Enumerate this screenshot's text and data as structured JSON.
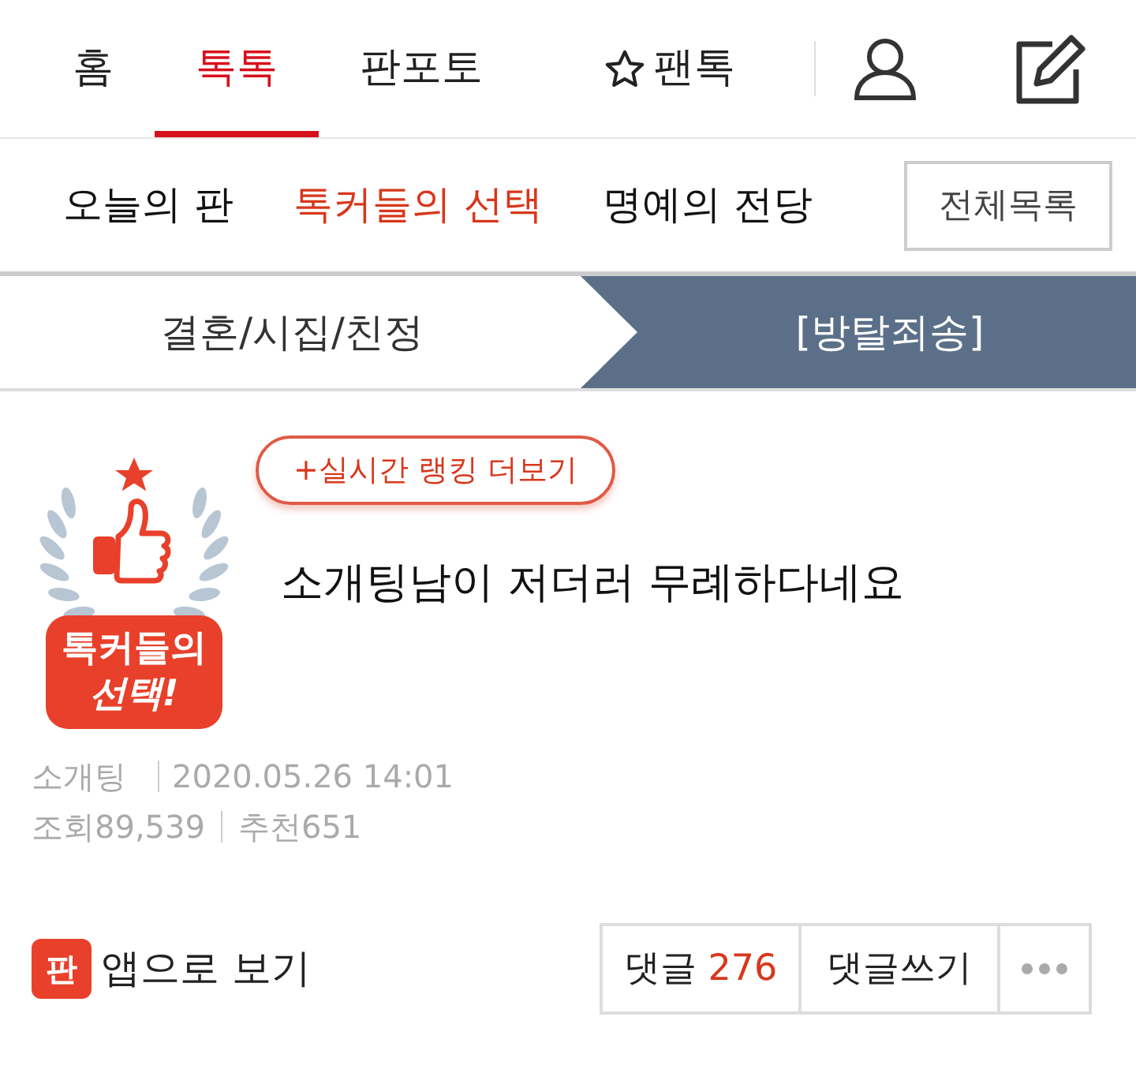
{
  "top_nav": {
    "tabs": [
      {
        "label": "홈",
        "selected": false,
        "star": false
      },
      {
        "label": "톡톡",
        "selected": true,
        "star": false
      },
      {
        "label": "판포토",
        "selected": false,
        "star": false
      },
      {
        "label": "팬톡",
        "selected": false,
        "star": true
      }
    ]
  },
  "sub_nav": {
    "items": [
      {
        "label": "오늘의 판",
        "selected": false
      },
      {
        "label": "톡커들의 선택",
        "selected": true
      },
      {
        "label": "명예의 전당",
        "selected": false
      }
    ],
    "all_button": "전체목록"
  },
  "breadcrumb": {
    "category": "결혼/시집/친정",
    "board": "[방탈죄송]"
  },
  "post": {
    "badge_text": [
      "톡커들의",
      "선택!"
    ],
    "ranking_button": "+실시간 랭킹 더보기",
    "title": "소개팅남이 저더러 무례하다네요",
    "author": "소개팅",
    "date": "2020.05.26 14:01",
    "views_label": "조회",
    "views": "89,539",
    "recommend_label": "추천",
    "recommend": "651"
  },
  "footer": {
    "app_icon_text": "판",
    "app_link": "앱으로 보기",
    "comments_label": "댓글",
    "comments_count": "276",
    "write_comment": "댓글쓰기"
  }
}
